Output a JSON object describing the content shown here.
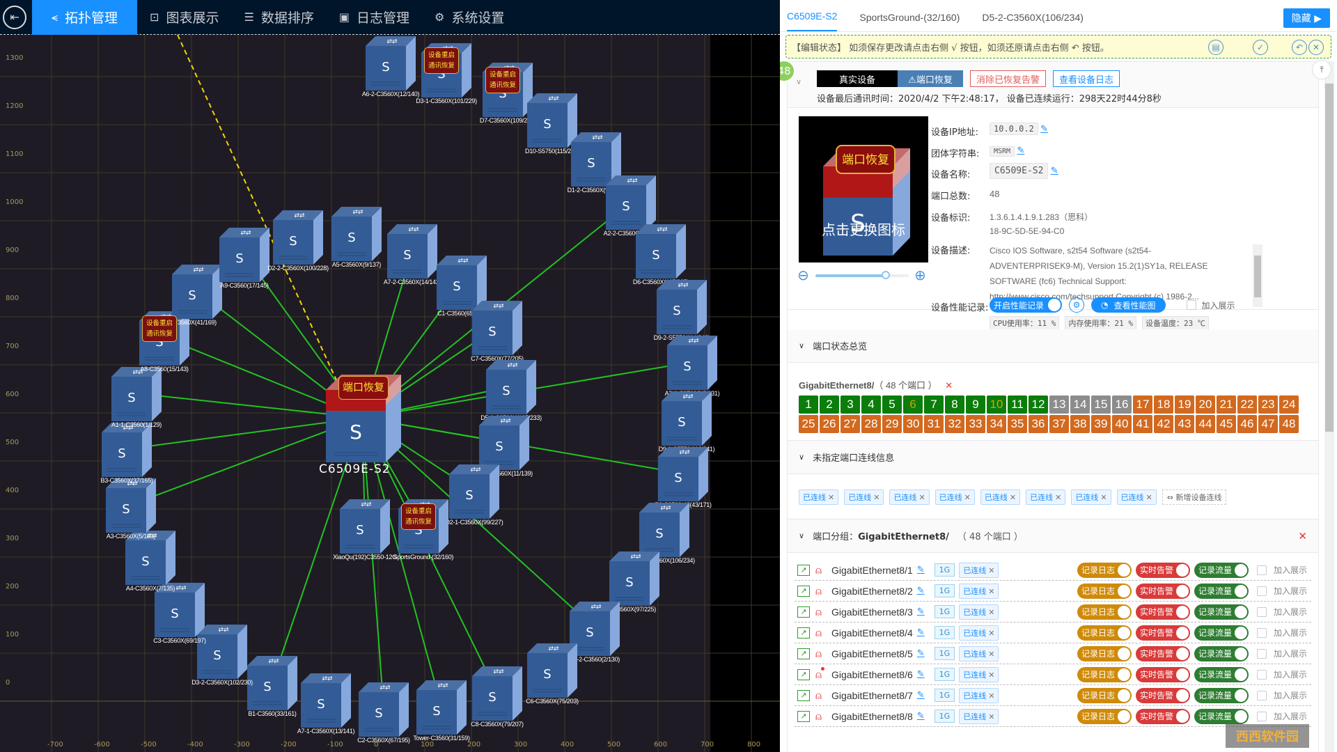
{
  "nav": {
    "back_icon": "exit-icon",
    "items": [
      {
        "label": "拓扑管理",
        "icon": "share-icon",
        "active": true
      },
      {
        "label": "图表展示",
        "icon": "presentation-chart-icon",
        "active": false
      },
      {
        "label": "数据排序",
        "icon": "ordered-list-icon",
        "active": false
      },
      {
        "label": "日志管理",
        "icon": "clipboard-icon",
        "active": false
      },
      {
        "label": "系统设置",
        "icon": "gear-icon",
        "active": false
      }
    ]
  },
  "topology": {
    "x_ticks": [
      "-700",
      "-600",
      "-500",
      "-400",
      "-300",
      "-200",
      "-100",
      "0",
      "100",
      "200",
      "300",
      "400",
      "500",
      "600",
      "700",
      "800"
    ],
    "y_ticks": [
      "1300",
      "1200",
      "1100",
      "1000",
      "900",
      "800",
      "700",
      "600",
      "500",
      "400",
      "300",
      "200",
      "100",
      "0"
    ],
    "core": {
      "name": "C6509E-S2",
      "alarm": "端口恢复"
    },
    "alarm_text_line1": "设备重启",
    "alarm_text_line2": "通讯恢复",
    "nodes": [
      {
        "label": "A6-2-C3560X(12/140)",
        "alarm": false
      },
      {
        "label": "D3-1-C3560X(101/229)",
        "alarm": true
      },
      {
        "label": "D7-C3560X(109/237)",
        "alarm": true
      },
      {
        "label": "D10-S5750(115/243)",
        "alarm": false
      },
      {
        "label": "D1-2-C3560X(98/226)",
        "alarm": false
      },
      {
        "label": "A2-2-C3560G(4/132)",
        "alarm": false
      },
      {
        "label": "D6-C3560X(107/235)",
        "alarm": false
      },
      {
        "label": "D9-2-S5750(114/242)",
        "alarm": false
      },
      {
        "label": "A2-1-C3560G(3/131)",
        "alarm": false
      },
      {
        "label": "D9-1-S5750(113/241)",
        "alarm": false
      },
      {
        "label": "B6-C3560-48(43/171)",
        "alarm": false
      },
      {
        "label": "D5-2-C3560X(106/234)",
        "alarm": false
      },
      {
        "label": "C3560X(97/225)",
        "alarm": false
      },
      {
        "label": "A1-2-C3560(2/130)",
        "alarm": false
      },
      {
        "label": "C6-C3560X(75/203)",
        "alarm": false
      },
      {
        "label": "C8-C3560X(79/207)",
        "alarm": false
      },
      {
        "label": "Tower-C3560(31/159)",
        "alarm": false
      },
      {
        "label": "C2-C3560X(67/195)",
        "alarm": false
      },
      {
        "label": "A7-1-C3560X(13/141)",
        "alarm": false
      },
      {
        "label": "B1-C3560(33/161)",
        "alarm": false
      },
      {
        "label": "D3-2-C3560X(102/230)",
        "alarm": false
      },
      {
        "label": "C3-C3560X(69/197)",
        "alarm": false
      },
      {
        "label": "A4-C3560X(7/135)",
        "alarm": false
      },
      {
        "label": "A3-C3560X(5/133)",
        "alarm": false
      },
      {
        "label": "B3-C3560X(37/165)",
        "alarm": false
      },
      {
        "label": "A1-1-C3560(1/129)",
        "alarm": false
      },
      {
        "label": "A8-C3560(15/143)",
        "alarm": true
      },
      {
        "label": "3560X(41/169)",
        "alarm": false
      },
      {
        "label": "A9-C3560(17/145)",
        "alarm": false
      },
      {
        "label": "D2-2-C3560X(100/228)",
        "alarm": false
      },
      {
        "label": "A5-C3560X(9/137)",
        "alarm": false
      },
      {
        "label": "A7-2-C3560X(14/142)",
        "alarm": false
      },
      {
        "label": "C1-C3560(65/193)",
        "alarm": false
      },
      {
        "label": "C7-C3560X(77/205)",
        "alarm": false
      },
      {
        "label": "D5-1-C3560X(105/233)",
        "alarm": false
      },
      {
        "label": "A6-1-C3560X(11/139)",
        "alarm": false
      },
      {
        "label": "D2-1-C3560X(99/227)",
        "alarm": false
      },
      {
        "label": "XiaoQu(192)C3550-12G",
        "alarm": false
      },
      {
        "label": "SportsGround-(32/160)",
        "alarm": true
      }
    ]
  },
  "panel": {
    "tabs": [
      "C6509E-S2",
      "SportsGround-(32/160)",
      "D5-2-C3560X(106/234)"
    ],
    "hide_label": "隐藏",
    "edit_notice": "【编辑状态】 如须保存更改请点击右侧 √ 按钮，如须还原请点击右侧 ↶ 按钮。",
    "badge_count": "48",
    "btn_real_device": "真实设备",
    "btn_port_recover": "⚠端口恢复",
    "btn_clear_alarm": "消除已恢复告警",
    "btn_view_log": "查看设备日志",
    "last_comm": "设备最后通讯时间：2020/4/2 下午2:48:17，  设备已连续运行：298天22时44分8秒",
    "icon_alarm": "端口恢复",
    "icon_caption": "点击更换图标",
    "icon_zoom": 0.75,
    "fields": {
      "ip_label": "设备IP地址:",
      "ip": "10.0.0.2",
      "community_label": "团体字符串:",
      "community": "MSRM",
      "name_label": "设备名称:",
      "name": "C6509E-S2",
      "ports_label": "端口总数:",
      "ports": "48",
      "oid_label": "设备标识:",
      "oid": "1.3.6.1.4.1.9.1.283（思科）",
      "mac": "18-9C-5D-5E-94-C0",
      "desc_label": "设备描述:",
      "desc": [
        "Cisco IOS Software, s2t54 Software (s2t54-",
        "ADVENTERPRISEK9-M), Version 15.2(1)SY1a, RELEASE",
        "SOFTWARE (fc6) Technical Support:",
        "http://www.cisco.com/techsupport Copyright (c) 1986-2..."
      ],
      "perf_label": "设备性能记录:",
      "perf_toggle": "开启性能记录",
      "perf_view": "查看性能图",
      "add_show": "加入展示",
      "cpu": "CPU使用率：11 %",
      "mem": "内存使用率：21 %",
      "temp": "设备温度：23 ℃"
    },
    "sec_port_overview": "端口状态总览",
    "port_group_title": "GigabitEthernet8/",
    "port_group_count": "（ 48 个端口 ）",
    "ports": [
      {
        "n": "1",
        "s": "up"
      },
      {
        "n": "2",
        "s": "up"
      },
      {
        "n": "3",
        "s": "up"
      },
      {
        "n": "4",
        "s": "up"
      },
      {
        "n": "5",
        "s": "up"
      },
      {
        "n": "6",
        "s": "warn"
      },
      {
        "n": "7",
        "s": "up"
      },
      {
        "n": "8",
        "s": "up"
      },
      {
        "n": "9",
        "s": "up"
      },
      {
        "n": "10",
        "s": "warn"
      },
      {
        "n": "11",
        "s": "up"
      },
      {
        "n": "12",
        "s": "up"
      },
      {
        "n": "13",
        "s": "off"
      },
      {
        "n": "14",
        "s": "off"
      },
      {
        "n": "15",
        "s": "off"
      },
      {
        "n": "16",
        "s": "off"
      },
      {
        "n": "17",
        "s": "down"
      },
      {
        "n": "18",
        "s": "down"
      },
      {
        "n": "19",
        "s": "down"
      },
      {
        "n": "20",
        "s": "down"
      },
      {
        "n": "21",
        "s": "down"
      },
      {
        "n": "22",
        "s": "down"
      },
      {
        "n": "23",
        "s": "down"
      },
      {
        "n": "24",
        "s": "down"
      },
      {
        "n": "25",
        "s": "down"
      },
      {
        "n": "26",
        "s": "down"
      },
      {
        "n": "27",
        "s": "down"
      },
      {
        "n": "28",
        "s": "down"
      },
      {
        "n": "29",
        "s": "down"
      },
      {
        "n": "30",
        "s": "down"
      },
      {
        "n": "31",
        "s": "down"
      },
      {
        "n": "32",
        "s": "down"
      },
      {
        "n": "33",
        "s": "down"
      },
      {
        "n": "34",
        "s": "down"
      },
      {
        "n": "35",
        "s": "down"
      },
      {
        "n": "36",
        "s": "down"
      },
      {
        "n": "37",
        "s": "down"
      },
      {
        "n": "38",
        "s": "down"
      },
      {
        "n": "39",
        "s": "down"
      },
      {
        "n": "40",
        "s": "down"
      },
      {
        "n": "41",
        "s": "down"
      },
      {
        "n": "42",
        "s": "down"
      },
      {
        "n": "43",
        "s": "down"
      },
      {
        "n": "44",
        "s": "down"
      },
      {
        "n": "45",
        "s": "down"
      },
      {
        "n": "46",
        "s": "down"
      },
      {
        "n": "47",
        "s": "down"
      },
      {
        "n": "48",
        "s": "down"
      }
    ],
    "port_colors": {
      "up": "#0a7d0a",
      "warn": "#0a7d0a",
      "off": "#8c8c8c",
      "down": "#d2691e"
    },
    "sec_unassigned": "未指定端口连线信息",
    "connected_tag": "已连线",
    "connected_count": 8,
    "add_connection": "⇔ 新增设备连线",
    "sec_group_label": "端口分组：",
    "sec_group_name": "GigabitEthernet8/",
    "sec_group_count": "（ 48 个端口 ）",
    "port_rows": [
      {
        "name": "GigabitEthernet8/1",
        "speed": "1G",
        "alert_dot": false
      },
      {
        "name": "GigabitEthernet8/2",
        "speed": "1G",
        "alert_dot": false
      },
      {
        "name": "GigabitEthernet8/3",
        "speed": "1G",
        "alert_dot": false
      },
      {
        "name": "GigabitEthernet8/4",
        "speed": "1G",
        "alert_dot": false
      },
      {
        "name": "GigabitEthernet8/5",
        "speed": "1G",
        "alert_dot": false
      },
      {
        "name": "GigabitEthernet8/6",
        "speed": "1G",
        "alert_dot": true
      },
      {
        "name": "GigabitEthernet8/7",
        "speed": "1G",
        "alert_dot": false
      },
      {
        "name": "GigabitEthernet8/8",
        "speed": "1G",
        "alert_dot": false
      }
    ],
    "row_labels": {
      "log": "记录日志",
      "alarm": "实时告警",
      "flow": "记录流量",
      "show": "加入展示",
      "conn": "已连线"
    },
    "watermark": "西西软件园"
  }
}
